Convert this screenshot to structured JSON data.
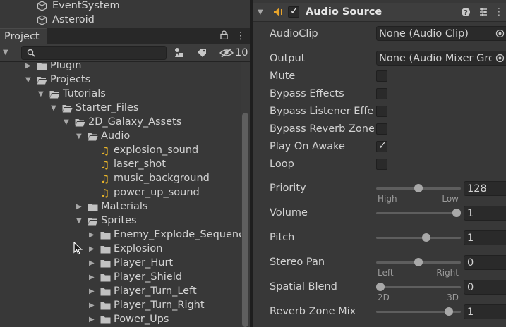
{
  "hierarchy": {
    "items": [
      {
        "label": "EventSystem"
      },
      {
        "label": "Asteroid"
      }
    ]
  },
  "project": {
    "tab_label": "Project",
    "item_count": "10",
    "tree": [
      {
        "label": "Plugin",
        "kind": "folder",
        "depth": 0,
        "expanded": false
      },
      {
        "label": "Projects",
        "kind": "folder",
        "depth": 0,
        "expanded": true
      },
      {
        "label": "Tutorials",
        "kind": "folder",
        "depth": 1,
        "expanded": true
      },
      {
        "label": "Starter_Files",
        "kind": "folder",
        "depth": 2,
        "expanded": true
      },
      {
        "label": "2D_Galaxy_Assets",
        "kind": "folder",
        "depth": 3,
        "expanded": true
      },
      {
        "label": "Audio",
        "kind": "folder",
        "depth": 4,
        "expanded": true
      },
      {
        "label": "explosion_sound",
        "kind": "audio",
        "depth": 5
      },
      {
        "label": "laser_shot",
        "kind": "audio",
        "depth": 5
      },
      {
        "label": "music_background",
        "kind": "audio",
        "depth": 5
      },
      {
        "label": "power_up_sound",
        "kind": "audio",
        "depth": 5
      },
      {
        "label": "Materials",
        "kind": "folder",
        "depth": 4,
        "expanded": false
      },
      {
        "label": "Sprites",
        "kind": "folder",
        "depth": 4,
        "expanded": true
      },
      {
        "label": "Enemy_Explode_Sequence",
        "kind": "folder",
        "depth": 5,
        "expanded": false
      },
      {
        "label": "Explosion",
        "kind": "folder",
        "depth": 5,
        "expanded": false
      },
      {
        "label": "Player_Hurt",
        "kind": "folder",
        "depth": 5,
        "expanded": false
      },
      {
        "label": "Player_Shield",
        "kind": "folder",
        "depth": 5,
        "expanded": false
      },
      {
        "label": "Player_Turn_Left",
        "kind": "folder",
        "depth": 5,
        "expanded": false
      },
      {
        "label": "Player_Turn_Right",
        "kind": "folder",
        "depth": 5,
        "expanded": false
      },
      {
        "label": "Power_Ups",
        "kind": "folder",
        "depth": 5,
        "expanded": false
      }
    ]
  },
  "inspector": {
    "component_title": "Audio Source",
    "enabled": true,
    "audio_clip": {
      "label": "AudioClip",
      "value": "None (Audio Clip)"
    },
    "output": {
      "label": "Output",
      "value": "None (Audio Mixer Group)"
    },
    "toggles": [
      {
        "label": "Mute",
        "checked": false
      },
      {
        "label": "Bypass Effects",
        "checked": false
      },
      {
        "label": "Bypass Listener Effects",
        "checked": false
      },
      {
        "label": "Bypass Reverb Zones",
        "checked": false
      },
      {
        "label": "Play On Awake",
        "checked": true
      },
      {
        "label": "Loop",
        "checked": false
      }
    ],
    "sliders": [
      {
        "label": "Priority",
        "value": "128",
        "fraction": 0.5,
        "min_label": "High",
        "max_label": "Low"
      },
      {
        "label": "Volume",
        "value": "1",
        "fraction": 1.0
      },
      {
        "label": "Pitch",
        "value": "1",
        "fraction": 0.6
      },
      {
        "label": "Stereo Pan",
        "value": "0",
        "fraction": 0.5,
        "min_label": "Left",
        "max_label": "Right"
      },
      {
        "label": "Spatial Blend",
        "value": "0",
        "fraction": 0.0,
        "min_label": "2D",
        "max_label": "3D"
      },
      {
        "label": "Reverb Zone Mix",
        "value": "1",
        "fraction": 0.9
      }
    ]
  }
}
